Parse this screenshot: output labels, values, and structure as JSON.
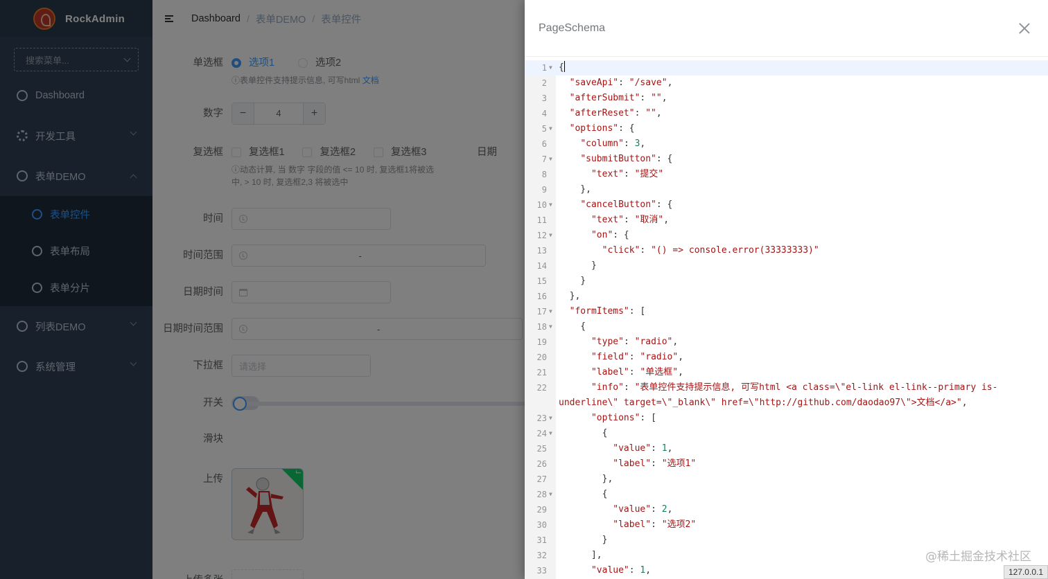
{
  "sidebar": {
    "brand": "RockAdmin",
    "search_placeholder": "搜索菜单...",
    "items": [
      {
        "label": "Dashboard",
        "icon": "circle-icon"
      },
      {
        "label": "开发工具",
        "icon": "gear-icon"
      },
      {
        "label": "表单DEMO",
        "icon": "circle-icon",
        "expanded": true,
        "children": [
          {
            "label": "表单控件",
            "active": true
          },
          {
            "label": "表单布局"
          },
          {
            "label": "表单分片"
          }
        ]
      },
      {
        "label": "列表DEMO",
        "icon": "circle-icon"
      },
      {
        "label": "系统管理",
        "icon": "circle-icon"
      }
    ]
  },
  "breadcrumb": [
    "Dashboard",
    "表单DEMO",
    "表单控件"
  ],
  "form": {
    "radio": {
      "label": "单选框",
      "options": [
        "选项1",
        "选项2"
      ],
      "selected": "选项1",
      "hint_prefix": "ⓘ表单控件支持提示信息, 可写html ",
      "hint_link": "文档"
    },
    "number": {
      "label": "数字",
      "value": "4",
      "minus": "−",
      "plus": "+"
    },
    "checkbox": {
      "label": "复选框",
      "options": [
        "复选框1",
        "复选框2",
        "复选框3"
      ],
      "hint_line1": "ⓘ动态计算, 当 数字 字段的值 <= 10 时, 复选框1将被选",
      "hint_line2": "中, > 10 时, 复选框2,3 将被选中"
    },
    "date_label_cut": "日期",
    "time": {
      "label": "时间"
    },
    "time_range": {
      "label": "时间范围",
      "sep": "-"
    },
    "datetime": {
      "label": "日期时间"
    },
    "datetime_range": {
      "label": "日期时间范围",
      "sep": "-"
    },
    "select": {
      "label": "下拉框",
      "placeholder": "请选择"
    },
    "switch": {
      "label": "开关"
    },
    "slider": {
      "label": "滑块",
      "value": 0
    },
    "upload": {
      "label": "上传"
    },
    "upload_multi": {
      "label": "上传多张"
    }
  },
  "drawer": {
    "title": "PageSchema",
    "code": [
      {
        "n": "1",
        "fold": true,
        "html": "{<span class='cursor'></span>"
      },
      {
        "n": "2",
        "fold": false,
        "html": "  <span class='s'>\"saveApi\"</span>: <span class='s'>\"/save\"</span>,"
      },
      {
        "n": "3",
        "fold": false,
        "html": "  <span class='s'>\"afterSubmit\"</span>: <span class='s'>\"\"</span>,"
      },
      {
        "n": "4",
        "fold": false,
        "html": "  <span class='s'>\"afterReset\"</span>: <span class='s'>\"\"</span>,"
      },
      {
        "n": "5",
        "fold": true,
        "html": "  <span class='s'>\"options\"</span>: {"
      },
      {
        "n": "6",
        "fold": false,
        "html": "    <span class='s'>\"column\"</span>: <span class='n'>3</span>,"
      },
      {
        "n": "7",
        "fold": true,
        "html": "    <span class='s'>\"submitButton\"</span>: {"
      },
      {
        "n": "8",
        "fold": false,
        "html": "      <span class='s'>\"text\"</span>: <span class='s'>\"提交\"</span>"
      },
      {
        "n": "9",
        "fold": false,
        "html": "    },"
      },
      {
        "n": "10",
        "fold": true,
        "html": "    <span class='s'>\"cancelButton\"</span>: {"
      },
      {
        "n": "11",
        "fold": false,
        "html": "      <span class='s'>\"text\"</span>: <span class='s'>\"取消\"</span>,"
      },
      {
        "n": "12",
        "fold": true,
        "html": "      <span class='s'>\"on\"</span>: {"
      },
      {
        "n": "13",
        "fold": false,
        "html": "        <span class='s'>\"click\"</span>: <span class='s'>\"() => console.error(33333333)\"</span>"
      },
      {
        "n": "14",
        "fold": false,
        "html": "      }"
      },
      {
        "n": "15",
        "fold": false,
        "html": "    }"
      },
      {
        "n": "16",
        "fold": false,
        "html": "  },"
      },
      {
        "n": "17",
        "fold": true,
        "html": "  <span class='s'>\"formItems\"</span>: ["
      },
      {
        "n": "18",
        "fold": true,
        "html": "    {"
      },
      {
        "n": "19",
        "fold": false,
        "html": "      <span class='s'>\"type\"</span>: <span class='s'>\"radio\"</span>,"
      },
      {
        "n": "20",
        "fold": false,
        "html": "      <span class='s'>\"field\"</span>: <span class='s'>\"radio\"</span>,"
      },
      {
        "n": "21",
        "fold": false,
        "html": "      <span class='s'>\"label\"</span>: <span class='s'>\"单选框\"</span>,"
      },
      {
        "n": "22",
        "fold": false,
        "html": "      <span class='s'>\"info\"</span>: <span class='s'>\"表单控件支持提示信息, 可写html &lt;a class=\\\"el-link el-link--primary is-</span>"
      },
      {
        "n": "",
        "fold": false,
        "html": "<span class='s'>underline\\\" target=\\\"_blank\\\" href=\\\"http://github.com/daodao97\\\"&gt;文档&lt;/a&gt;\"</span>,"
      },
      {
        "n": "23",
        "fold": true,
        "html": "      <span class='s'>\"options\"</span>: ["
      },
      {
        "n": "24",
        "fold": true,
        "html": "        {"
      },
      {
        "n": "25",
        "fold": false,
        "html": "          <span class='s'>\"value\"</span>: <span class='n'>1</span>,"
      },
      {
        "n": "26",
        "fold": false,
        "html": "          <span class='s'>\"label\"</span>: <span class='s'>\"选项1\"</span>"
      },
      {
        "n": "27",
        "fold": false,
        "html": "        },"
      },
      {
        "n": "28",
        "fold": true,
        "html": "        {"
      },
      {
        "n": "29",
        "fold": false,
        "html": "          <span class='s'>\"value\"</span>: <span class='n'>2</span>,"
      },
      {
        "n": "30",
        "fold": false,
        "html": "          <span class='s'>\"label\"</span>: <span class='s'>\"选项2\"</span>"
      },
      {
        "n": "31",
        "fold": false,
        "html": "        }"
      },
      {
        "n": "32",
        "fold": false,
        "html": "      ],"
      },
      {
        "n": "33",
        "fold": false,
        "html": "      <span class='s'>\"value\"</span>: <span class='n'>1</span>,"
      }
    ]
  },
  "watermark": "@稀土掘金技术社区",
  "status_tip": "127.0.0.1",
  "colors": {
    "sidebar_bg": "#304156",
    "accent": "#409eff",
    "overlay": "rgba(0,0,0,0.5)"
  }
}
